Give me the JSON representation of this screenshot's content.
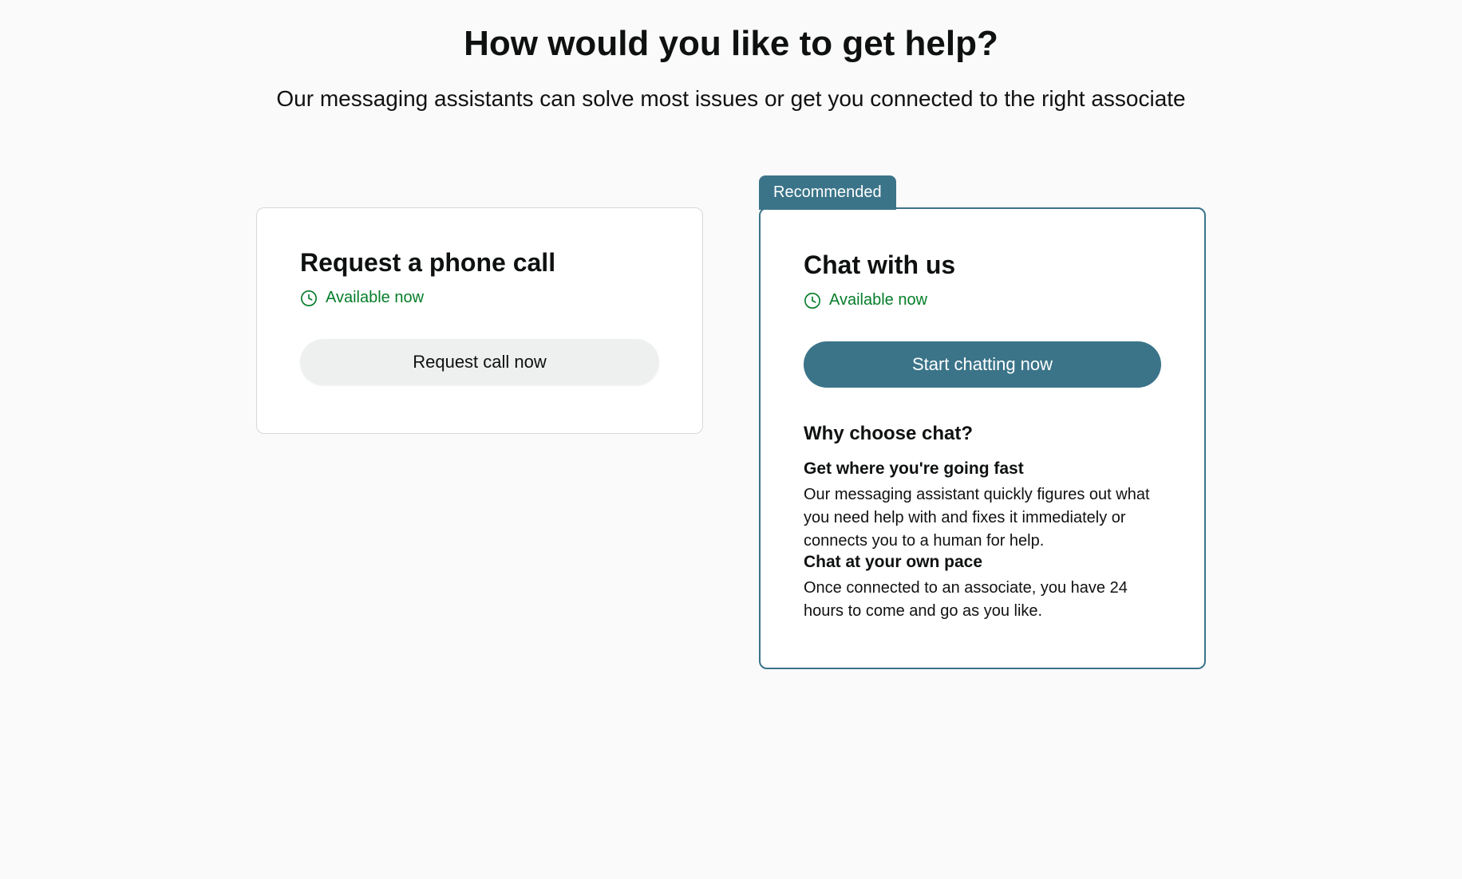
{
  "header": {
    "title": "How would you like to get help?",
    "subtitle": "Our messaging assistants can solve most issues or get you connected to the right associate"
  },
  "phone_card": {
    "title": "Request a phone call",
    "status": "Available now",
    "button_label": "Request call now"
  },
  "chat_card": {
    "badge": "Recommended",
    "title": "Chat with us",
    "status": "Available now",
    "button_label": "Start chatting now",
    "why_title": "Why choose chat?",
    "benefits": [
      {
        "title": "Get where you're going fast",
        "text": "Our messaging assistant quickly figures out what you need help with and fixes it immediately or connects you to a human for help."
      },
      {
        "title": "Chat at your own pace",
        "text": "Once connected to an associate, you have 24 hours to come and go as you like."
      }
    ]
  },
  "colors": {
    "accent": "#3b7489",
    "status_green": "#067d2a"
  }
}
